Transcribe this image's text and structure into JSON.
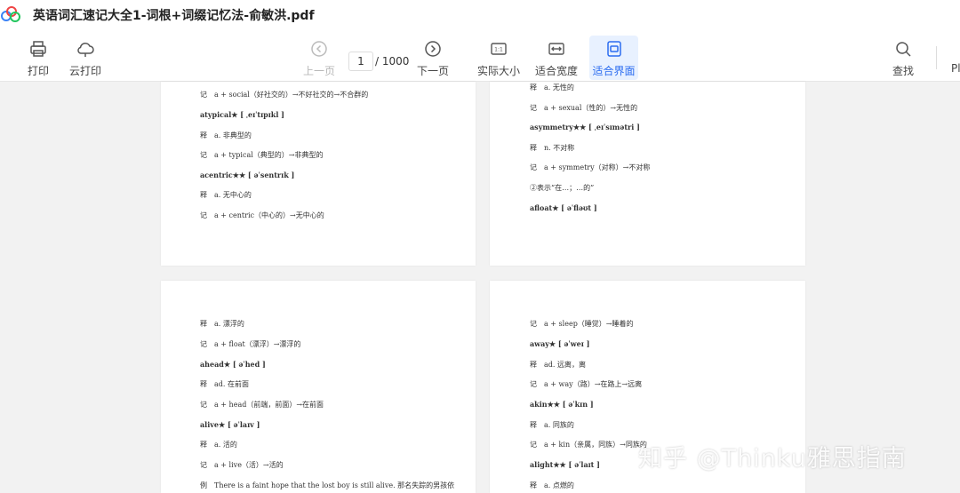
{
  "window": {
    "title": "英语词汇速记大全1-词根+词缀记忆法-俞敏洪.pdf"
  },
  "toolbar": {
    "print": "打印",
    "cloud_print": "云打印",
    "prev_page": "上一页",
    "current_page": "1",
    "total_pages": "/ 1000",
    "next_page": "下一页",
    "actual_size": "实际大小",
    "fit_width": "适合宽度",
    "fit_page": "适合界面",
    "search": "查找",
    "cut_label": "Pl"
  },
  "pages": {
    "top_left": [
      "记　a + social（好社交的）→不好社交的→不合群的",
      "atypical★ [ ˌeɪˈtɪpɪkl ]",
      "释　a. 非典型的",
      "记　a + typical（典型的）→非典型的",
      "acentric★★ [ əˈsentrɪk ]",
      "释　a. 无中心的",
      "记　a + centric（中心的）→无中心的"
    ],
    "top_right": [
      "释　a. 无性的",
      "记　a + sexual（性的）→无性的",
      "asymmetry★★ [ ˌeɪˈsɪmətri ]",
      "释　n. 不对称",
      "记　a + symmetry（对称）→不对称",
      "②表示“在…；…的”",
      "afloat★ [ əˈfləʊt ]"
    ],
    "bottom_left": [
      "释　a. 漂浮的",
      "记　a + float（漂浮）→漂浮的",
      "ahead★ [ əˈhed ]",
      "释　ad. 在前面",
      "记　a + head（前端，前面）→在前面",
      "alive★ [ əˈlaɪv ]",
      "释　a. 活的",
      "记　a + live（活）→活的",
      "例　There is a faint hope that the lost boy is still alive. 那名失踪的男孩依"
    ],
    "bottom_right": [
      "记　a + sleep（睡觉）→睡着的",
      "away★ [ əˈweɪ ]",
      "释　ad. 远离，离",
      "记　a + way（路）→在路上→远离",
      "akin★★ [ əˈkɪn ]",
      "释　a. 同族的",
      "记　a + kin（亲属，同族）→同族的",
      "alight★★ [ əˈlaɪt ]",
      "释　a. 点燃的"
    ]
  },
  "watermark": "知乎 @Thinku雅思指南",
  "colors": {
    "accent": "#2b6cf0",
    "active_bg": "#e8f1ff",
    "canvas": "#f2f2f2"
  }
}
